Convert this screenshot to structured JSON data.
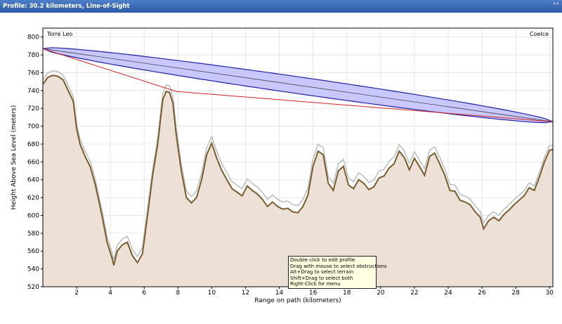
{
  "window": {
    "title": "Profile: 30.2 kilometers, Line-of-Sight",
    "collapse_glyph": "˄˄"
  },
  "chart_data": {
    "type": "area",
    "xlabel": "Range on path (kilometers)",
    "ylabel": "Height Above Sea Level (meters)",
    "xlim": [
      0,
      30.2
    ],
    "ylim": [
      520,
      810
    ],
    "xticks": [
      2,
      4,
      6,
      8,
      10,
      12,
      14,
      16,
      18,
      20,
      22,
      24,
      26,
      28,
      30
    ],
    "yticks": [
      520,
      540,
      560,
      580,
      600,
      620,
      640,
      660,
      680,
      700,
      720,
      740,
      760,
      780,
      800
    ],
    "endpoint_labels": {
      "start": "Torre Leo",
      "end": "Coelce"
    },
    "grid": true,
    "antenna_heights": {
      "start": 787,
      "end": 705
    },
    "fresnel_max_halfwidth": 9.5,
    "obstruction_point": {
      "x": 7.9,
      "y": 739
    },
    "colors": {
      "terrain_fill": "#ede1d7",
      "terrain_line": "#7a5c2e",
      "earth_curve_line": "#bcbcbc",
      "fresnel_fill": "#c2c2ff",
      "fresnel_stroke": "#2020a8",
      "los_line": "#d62020",
      "grid": "#e2e2e2"
    },
    "terrain": {
      "x": [
        0,
        0.3,
        0.6,
        0.9,
        1.2,
        1.5,
        1.8,
        2.0,
        2.2,
        2.5,
        2.8,
        3.1,
        3.5,
        3.8,
        4.1,
        4.2,
        4.4,
        4.7,
        5.0,
        5.3,
        5.6,
        5.9,
        6.2,
        6.5,
        6.8,
        7.1,
        7.3,
        7.5,
        7.7,
        7.9,
        8.2,
        8.5,
        8.8,
        9.1,
        9.4,
        9.7,
        10.0,
        10.3,
        10.6,
        10.9,
        11.2,
        11.5,
        11.8,
        12.1,
        12.4,
        12.7,
        13.0,
        13.3,
        13.6,
        13.9,
        14.2,
        14.5,
        14.8,
        15.1,
        15.4,
        15.7,
        16.0,
        16.3,
        16.6,
        16.9,
        17.2,
        17.5,
        17.8,
        18.1,
        18.4,
        18.7,
        19.0,
        19.3,
        19.6,
        19.9,
        20.2,
        20.5,
        20.8,
        21.1,
        21.4,
        21.7,
        22.0,
        22.3,
        22.6,
        22.9,
        23.2,
        23.5,
        23.8,
        24.1,
        24.4,
        24.7,
        25.0,
        25.3,
        25.6,
        25.9,
        26.1,
        26.4,
        26.7,
        27.0,
        27.3,
        27.6,
        27.9,
        28.2,
        28.5,
        28.8,
        29.1,
        29.4,
        29.7,
        30.0,
        30.2
      ],
      "y": [
        747,
        755,
        757,
        756,
        752,
        740,
        728,
        697,
        680,
        666,
        655,
        635,
        600,
        570,
        552,
        544,
        560,
        567,
        570,
        555,
        547,
        557,
        600,
        645,
        680,
        730,
        739,
        738,
        726,
        690,
        650,
        620,
        614,
        620,
        640,
        668,
        681,
        664,
        650,
        640,
        630,
        626,
        622,
        633,
        628,
        624,
        618,
        610,
        615,
        610,
        607,
        608,
        604,
        603,
        610,
        623,
        655,
        672,
        668,
        636,
        628,
        650,
        655,
        634,
        630,
        640,
        636,
        629,
        632,
        642,
        644,
        653,
        658,
        672,
        665,
        651,
        664,
        655,
        645,
        666,
        670,
        658,
        645,
        628,
        627,
        617,
        615,
        612,
        604,
        598,
        585,
        594,
        598,
        594,
        601,
        606,
        612,
        617,
        622,
        631,
        628,
        643,
        660,
        673,
        674
      ],
      "earth_curve_offset": 8
    }
  },
  "tooltip": {
    "lines": [
      "Double-click to edit profile",
      "Drag with mouse to select obstructions",
      "Alt+Drag to select terrain",
      "Shift+Drag to select both",
      "Right-Click for menu"
    ]
  }
}
